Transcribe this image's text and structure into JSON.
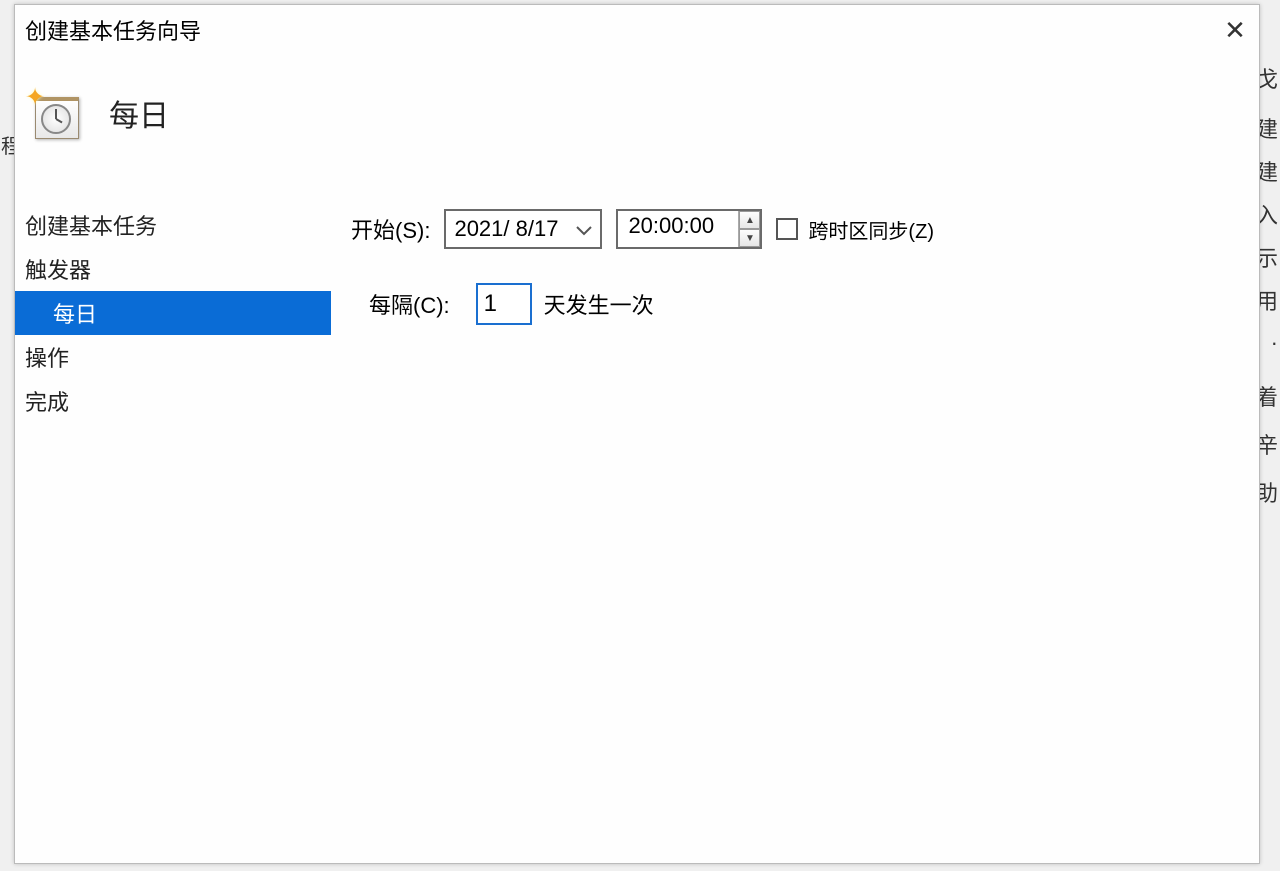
{
  "dialog": {
    "title": "创建基本任务向导",
    "page_heading": "每日"
  },
  "sidebar": {
    "items": [
      {
        "label": "创建基本任务",
        "sub": false,
        "selected": false
      },
      {
        "label": "触发器",
        "sub": false,
        "selected": false
      },
      {
        "label": "每日",
        "sub": true,
        "selected": true
      },
      {
        "label": "操作",
        "sub": false,
        "selected": false
      },
      {
        "label": "完成",
        "sub": false,
        "selected": false
      }
    ]
  },
  "form": {
    "start_label": "开始(S):",
    "date_value": "2021/ 8/17",
    "time_value": "20:00:00",
    "sync_tz_label": "跨时区同步(Z)",
    "sync_tz_checked": false,
    "recur_label": "每隔(C):",
    "recur_value": "1",
    "recur_suffix": "天发生一次"
  },
  "bg": {
    "left_text": "程",
    "right_items": [
      "戈",
      "建",
      "建",
      "入",
      "示",
      "用",
      "·",
      "着",
      "辛",
      "助"
    ]
  }
}
